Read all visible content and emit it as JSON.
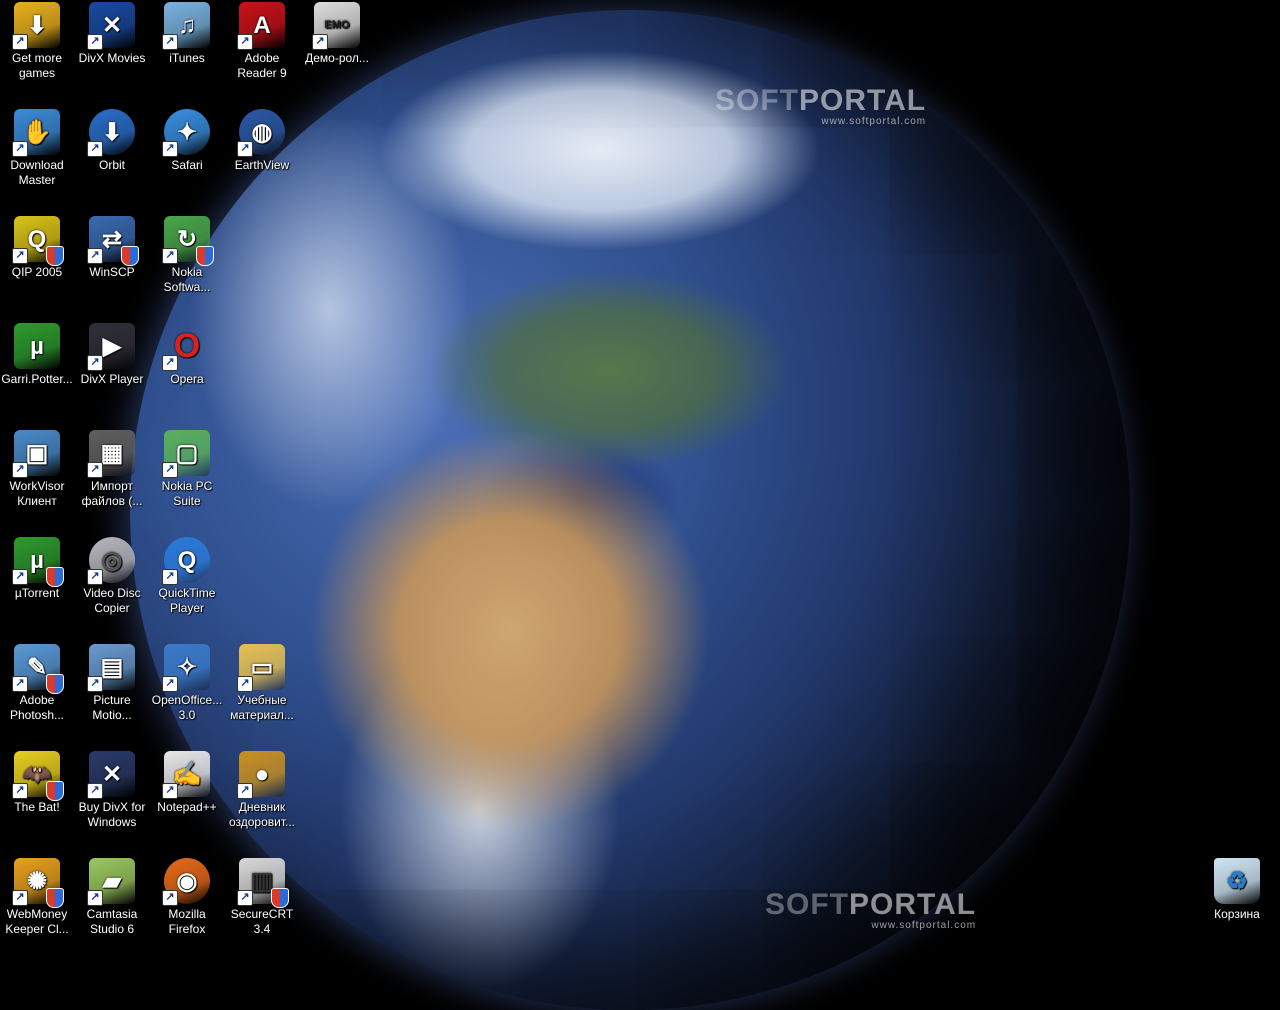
{
  "watermarks": [
    {
      "brand_a": "SOFT",
      "brand_b": "PORTAL",
      "url": "www.softportal.com"
    },
    {
      "brand_a": "SOFT",
      "brand_b": "PORTAL",
      "url": "www.softportal.com"
    }
  ],
  "icons": [
    {
      "label": "Get more games",
      "icon": "download-arrow-icon",
      "color": "#e8b020",
      "glyph": "⬇"
    },
    {
      "label": "DivX Movies",
      "icon": "divx-movies-icon",
      "color": "#1a4aa0",
      "glyph": "✕"
    },
    {
      "label": "iTunes",
      "icon": "itunes-icon",
      "color": "#7ab3e0",
      "glyph": "♫"
    },
    {
      "label": "Adobe Reader 9",
      "icon": "adobe-reader-icon",
      "color": "#c8121a",
      "glyph": "A"
    },
    {
      "label": "Демо-рол...",
      "icon": "clapperboard-icon",
      "color": "#dddddd",
      "glyph": "EMO"
    },
    {
      "label": "Download Master",
      "icon": "download-master-icon",
      "color": "#3d8ad8",
      "glyph": "✋"
    },
    {
      "label": "Orbit",
      "icon": "orbit-download-icon",
      "color": "#2a6ec8",
      "glyph": "⬇"
    },
    {
      "label": "Safari",
      "icon": "safari-compass-icon",
      "color": "#3a8ee0",
      "glyph": "✦"
    },
    {
      "label": "EarthView",
      "icon": "globe-icon",
      "color": "#2b5aa8",
      "glyph": "◍"
    },
    {
      "label": "QIP 2005",
      "icon": "qip-icon",
      "color": "#d8c21a",
      "glyph": "Q"
    },
    {
      "label": "WinSCP",
      "icon": "winscp-icon",
      "color": "#3a6ab0",
      "glyph": "⇄"
    },
    {
      "label": "Nokia Softwa...",
      "icon": "nokia-software-icon",
      "color": "#4aa84a",
      "glyph": "↻"
    },
    {
      "label": "Garri.Potter...",
      "icon": "utorrent-file-icon",
      "color": "#2e9a2e",
      "glyph": "µ"
    },
    {
      "label": "DivX Player",
      "icon": "divx-player-icon",
      "color": "#30303a",
      "glyph": "▶"
    },
    {
      "label": "Opera",
      "icon": "opera-icon",
      "color": "#c81e1e",
      "glyph": "O"
    },
    {
      "label": "WorkVisor Клиент",
      "icon": "workvisor-icon",
      "color": "#4a8ac8",
      "glyph": "▣"
    },
    {
      "label": "Импорт файлов (...",
      "icon": "import-files-icon",
      "color": "#606060",
      "glyph": "▦"
    },
    {
      "label": "Nokia PC Suite",
      "icon": "nokia-pc-suite-icon",
      "color": "#5ab05a",
      "glyph": "▢"
    },
    {
      "label": "µTorrent",
      "icon": "utorrent-icon",
      "color": "#2e9a2e",
      "glyph": "µ"
    },
    {
      "label": "Video Disc Copier",
      "icon": "disc-icon",
      "color": "#b8b8c0",
      "glyph": "◎"
    },
    {
      "label": "QuickTime Player",
      "icon": "quicktime-icon",
      "color": "#2a7ad8",
      "glyph": "Q"
    },
    {
      "label": "Adobe Photosh...",
      "icon": "photoshop-feather-icon",
      "color": "#5a9ad8",
      "glyph": "✎"
    },
    {
      "label": "Picture Motio...",
      "icon": "picture-motion-icon",
      "color": "#6a9ad0",
      "glyph": "▤"
    },
    {
      "label": "OpenOffice... 3.0",
      "icon": "openoffice-icon",
      "color": "#3a7ac8",
      "glyph": "✧"
    },
    {
      "label": "Учебные материал...",
      "icon": "folder-icon",
      "color": "#e8c050",
      "glyph": "▭"
    },
    {
      "label": "The Bat!",
      "icon": "the-bat-icon",
      "color": "#e8d020",
      "glyph": "🦇"
    },
    {
      "label": "Buy DivX for Windows",
      "icon": "buy-divx-icon",
      "color": "#2a3a6a",
      "glyph": "✕"
    },
    {
      "label": "Notepad++",
      "icon": "notepad-icon",
      "color": "#e8e8e8",
      "glyph": "✍"
    },
    {
      "label": "Дневник оздоровит...",
      "icon": "coins-icon",
      "color": "#c89020",
      "glyph": "●"
    },
    {
      "label": "WebMoney Keeper Cl...",
      "icon": "webmoney-bee-icon",
      "color": "#e8a020",
      "glyph": "✺"
    },
    {
      "label": "Camtasia Studio 6",
      "icon": "camtasia-icon",
      "color": "#9ac860",
      "glyph": "▰"
    },
    {
      "label": "Mozilla Firefox",
      "icon": "firefox-icon",
      "color": "#e86a1a",
      "glyph": "◉"
    },
    {
      "label": "SecureCRT 3.4",
      "icon": "securecrt-icon",
      "color": "#d8d8d8",
      "glyph": "▥"
    },
    {
      "label": "Корзина",
      "icon": "recycle-bin-icon",
      "color": "#cfe6f5",
      "glyph": "♻"
    }
  ]
}
